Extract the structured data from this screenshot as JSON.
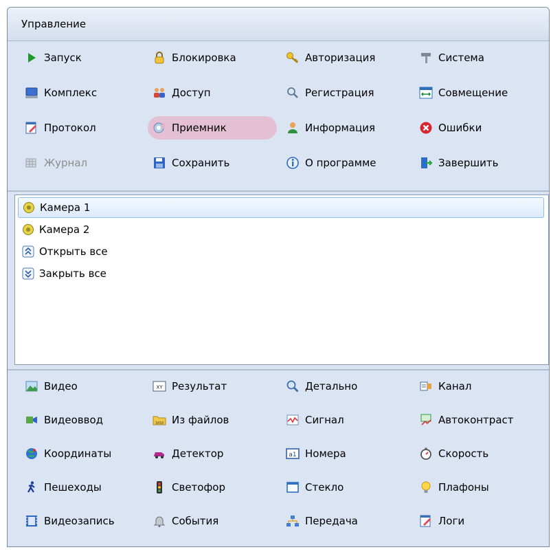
{
  "window": {
    "title": "Управление"
  },
  "top_tools": [
    {
      "label": "Запуск",
      "icon": "play-icon",
      "state": "normal"
    },
    {
      "label": "Блокировка",
      "icon": "lock-icon",
      "state": "normal"
    },
    {
      "label": "Авторизация",
      "icon": "key-icon",
      "state": "normal"
    },
    {
      "label": "Система",
      "icon": "hammer-icon",
      "state": "normal"
    },
    {
      "label": "Комплекс",
      "icon": "computer-icon",
      "state": "normal"
    },
    {
      "label": "Доступ",
      "icon": "users-icon",
      "state": "normal"
    },
    {
      "label": "Регистрация",
      "icon": "magnifier-key-icon",
      "state": "normal"
    },
    {
      "label": "Совмещение",
      "icon": "merge-icon",
      "state": "normal"
    },
    {
      "label": "Протокол",
      "icon": "edit-document-icon",
      "state": "normal"
    },
    {
      "label": "Приемник",
      "icon": "receiver-icon",
      "state": "hover"
    },
    {
      "label": "Информация",
      "icon": "person-info-icon",
      "state": "normal"
    },
    {
      "label": "Ошибки",
      "icon": "error-icon",
      "state": "normal"
    },
    {
      "label": "Журнал",
      "icon": "journal-grid-icon",
      "state": "disabled"
    },
    {
      "label": "Сохранить",
      "icon": "floppy-disk-icon",
      "state": "normal"
    },
    {
      "label": "О программе",
      "icon": "info-icon",
      "state": "normal"
    },
    {
      "label": "Завершить",
      "icon": "exit-door-icon",
      "state": "normal"
    }
  ],
  "list_items": [
    {
      "label": "Камера 1",
      "icon": "camera-ball-icon",
      "selected": true
    },
    {
      "label": "Камера 2",
      "icon": "camera-ball-icon",
      "selected": false
    },
    {
      "label": "Открыть все",
      "icon": "expand-all-icon",
      "selected": false
    },
    {
      "label": "Закрыть все",
      "icon": "collapse-all-icon",
      "selected": false
    }
  ],
  "bottom_tools": [
    {
      "label": "Видео",
      "icon": "landscape-image-icon",
      "state": "normal"
    },
    {
      "label": "Результат",
      "icon": "xy-result-icon",
      "state": "normal"
    },
    {
      "label": "Детально",
      "icon": "magnifier-icon",
      "state": "normal"
    },
    {
      "label": "Канал",
      "icon": "channel-icon",
      "state": "normal"
    },
    {
      "label": "Видеоввод",
      "icon": "video-input-icon",
      "state": "normal"
    },
    {
      "label": "Из файлов",
      "icon": "folder-binary-icon",
      "state": "normal"
    },
    {
      "label": "Сигнал",
      "icon": "signal-wave-icon",
      "state": "normal"
    },
    {
      "label": "Автоконтраст",
      "icon": "auto-contrast-icon",
      "state": "normal"
    },
    {
      "label": "Координаты",
      "icon": "globe-icon",
      "state": "normal"
    },
    {
      "label": "Детектор",
      "icon": "car-icon",
      "state": "normal"
    },
    {
      "label": "Номера",
      "icon": "plate-number-icon",
      "state": "normal"
    },
    {
      "label": "Скорость",
      "icon": "stopwatch-icon",
      "state": "normal"
    },
    {
      "label": "Пешеходы",
      "icon": "pedestrian-icon",
      "state": "normal"
    },
    {
      "label": "Светофор",
      "icon": "traffic-light-icon",
      "state": "normal"
    },
    {
      "label": "Стекло",
      "icon": "window-glass-icon",
      "state": "normal"
    },
    {
      "label": "Плафоны",
      "icon": "light-bulb-icon",
      "state": "normal"
    },
    {
      "label": "Видеозапись",
      "icon": "film-icon",
      "state": "normal"
    },
    {
      "label": "События",
      "icon": "bell-icon",
      "state": "normal"
    },
    {
      "label": "Передача",
      "icon": "network-transfer-icon",
      "state": "normal"
    },
    {
      "label": "Логи",
      "icon": "edit-document-icon",
      "state": "normal"
    }
  ],
  "colors": {
    "panel_bg": "#dbe4f2",
    "hover_highlight": "#e3c0d3",
    "selection_border": "#8fbde8",
    "disabled_text": "#8d8d8d"
  }
}
